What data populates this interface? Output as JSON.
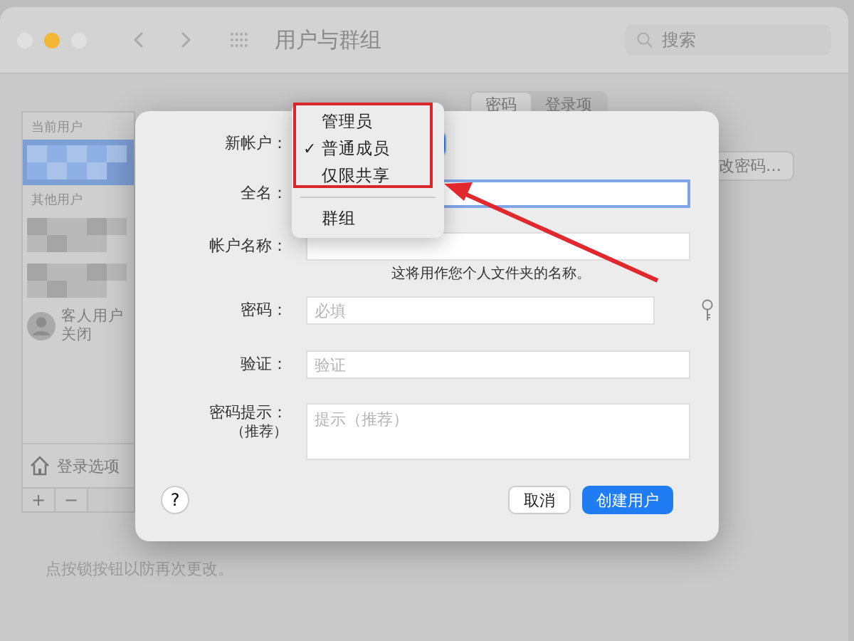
{
  "window": {
    "title": "用户与群组",
    "search": {
      "placeholder": "搜索"
    }
  },
  "tabs": [
    {
      "label": "密码",
      "selected": true
    },
    {
      "label": "登录项",
      "selected": false
    }
  ],
  "sidebar": {
    "sections": [
      {
        "heading": "当前用户",
        "users": [
          {
            "kind": "blurred",
            "selected": true
          }
        ]
      },
      {
        "heading": "其他用户",
        "users": [
          {
            "kind": "blurred",
            "selected": false
          },
          {
            "kind": "blurred",
            "selected": false
          },
          {
            "kind": "guest",
            "name": "客人用户",
            "status": "关闭",
            "selected": false
          }
        ]
      }
    ],
    "login_options": "登录选项",
    "add_button": "+",
    "remove_button": "−"
  },
  "change_password_button": "改密码…",
  "lock_message": "点按锁按钮以防再次更改。",
  "dialog": {
    "fields": [
      {
        "kind": "popup",
        "label": "新帐户："
      },
      {
        "kind": "text",
        "label": "全名：",
        "focused": true
      },
      {
        "kind": "text",
        "label": "帐户名称：",
        "focused": false,
        "note": "这将用作您个人文件夹的名称。"
      },
      {
        "kind": "password",
        "label": "密码：",
        "placeholder": "必填",
        "focused": false
      },
      {
        "kind": "text",
        "label": "验证：",
        "placeholder": "验证",
        "focused": false
      },
      {
        "kind": "textarea",
        "label": "密码提示：",
        "sublabel": "（推荐）",
        "placeholder": "提示（推荐）"
      }
    ],
    "help_button": "?",
    "cancel_button": "取消",
    "create_button": "创建用户"
  },
  "menu": {
    "check_mark": "✓",
    "groups": [
      [
        {
          "label": "管理员",
          "selected": false
        },
        {
          "label": "普通成员",
          "selected": true
        },
        {
          "label": "仅限共享",
          "selected": false
        }
      ],
      [
        {
          "label": "群组",
          "selected": false
        }
      ]
    ]
  }
}
